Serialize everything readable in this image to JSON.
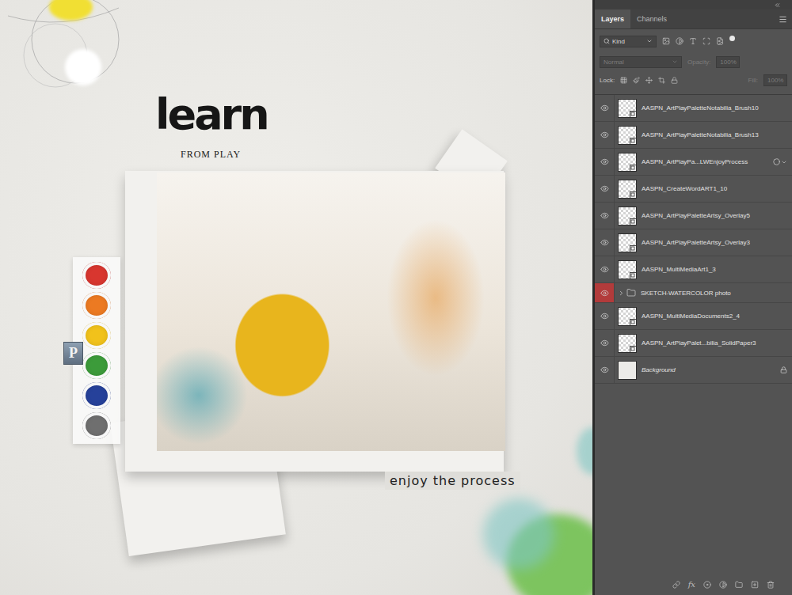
{
  "canvas": {
    "title": "learn",
    "subtitle": "FROM PLAY",
    "caption": "enjoy the process",
    "tile_letter": "P",
    "paint_pans": [
      {
        "color": "#d8362f"
      },
      {
        "color": "#ec7a22"
      },
      {
        "color": "#f1c21b"
      },
      {
        "color": "#3c9b3a"
      },
      {
        "color": "#26419a"
      },
      {
        "color": "#6f6f6f"
      }
    ]
  },
  "tabs": [
    {
      "label": "Layers",
      "selected": true
    },
    {
      "label": "Channels",
      "selected": false
    }
  ],
  "filter": {
    "label": "Kind"
  },
  "blend": {
    "mode": "Normal",
    "disabled": true
  },
  "opacity": {
    "label": "Opacity:",
    "value": "100%",
    "disabled": true
  },
  "lock": {
    "label": "Lock:"
  },
  "fill": {
    "label": "Fill:",
    "value": "100%",
    "disabled": true
  },
  "layers": [
    {
      "name": "AASPN_ArtPlayPaletteNotabilia_Brush10",
      "kind": "layer",
      "visible": true,
      "smart_object": true,
      "has_effects": false,
      "locked": false
    },
    {
      "name": "AASPN_ArtPlayPaletteNotabilia_Brush13",
      "kind": "layer",
      "visible": true,
      "smart_object": true,
      "has_effects": false,
      "locked": false
    },
    {
      "name": "AASPN_ArtPlayPa...LWEnjoyProcess",
      "kind": "layer",
      "visible": true,
      "smart_object": true,
      "has_effects": true,
      "locked": false
    },
    {
      "name": "AASPN_CreateWordART1_10",
      "kind": "layer",
      "visible": true,
      "smart_object": true,
      "has_effects": false,
      "locked": false
    },
    {
      "name": "AASPN_ArtPlayPaletteArtsy_Overlay5",
      "kind": "layer",
      "visible": true,
      "smart_object": true,
      "has_effects": false,
      "locked": false
    },
    {
      "name": "AASPN_ArtPlayPaletteArtsy_Overlay3",
      "kind": "layer",
      "visible": true,
      "smart_object": true,
      "has_effects": false,
      "locked": false
    },
    {
      "name": "AASPN_MultiMediaArt1_3",
      "kind": "layer",
      "visible": true,
      "smart_object": true,
      "has_effects": false,
      "locked": false
    },
    {
      "name": "SKETCH-WATERCOLOR photo",
      "kind": "group",
      "visible": true,
      "smart_object": false,
      "has_effects": false,
      "locked": false,
      "expanded": false,
      "color": "#b23b3b"
    },
    {
      "name": "AASPN_MultiMediaDocuments2_4",
      "kind": "layer",
      "visible": true,
      "smart_object": true,
      "has_effects": false,
      "locked": false
    },
    {
      "name": "AASPN_ArtPlayPalet...bilia_SolidPaper3",
      "kind": "layer",
      "visible": true,
      "smart_object": true,
      "has_effects": false,
      "locked": false
    },
    {
      "name": "Background",
      "kind": "background",
      "visible": true,
      "smart_object": false,
      "has_effects": false,
      "locked": true
    }
  ],
  "footer": {
    "fx_label": "fx"
  }
}
